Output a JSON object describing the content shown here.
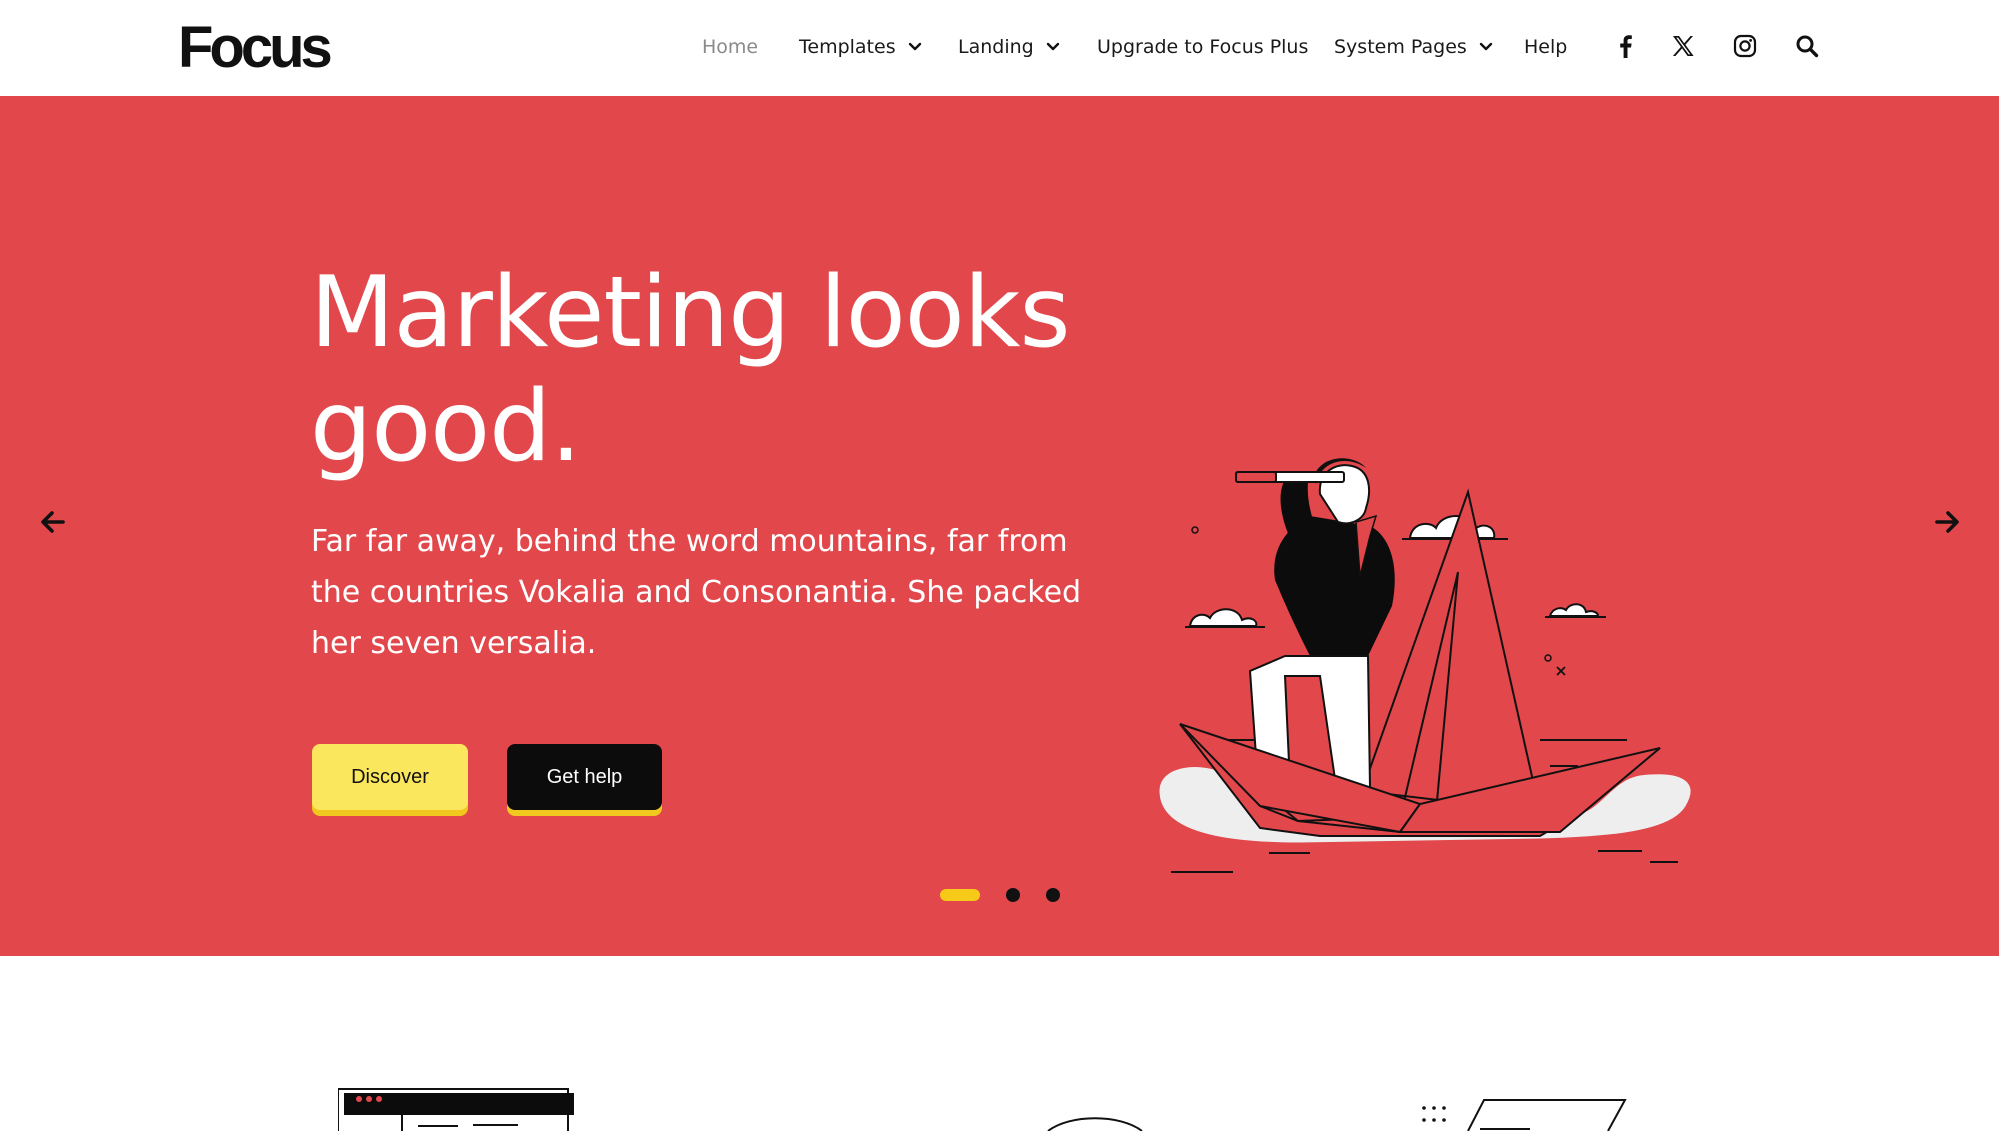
{
  "brand": {
    "logo": "Focus"
  },
  "nav": {
    "items": [
      {
        "label": "Home",
        "dropdown": false
      },
      {
        "label": "Templates",
        "dropdown": true
      },
      {
        "label": "Landing",
        "dropdown": true
      },
      {
        "label": "Upgrade to Focus Plus",
        "dropdown": false
      },
      {
        "label": "System Pages",
        "dropdown": true
      },
      {
        "label": "Help",
        "dropdown": false
      }
    ],
    "social_icons": [
      "facebook-icon",
      "x-icon",
      "instagram-icon",
      "search-icon"
    ]
  },
  "hero": {
    "title_line1": "Marketing looks",
    "title_line2": "good.",
    "text": "Far far away, behind the word mountains, far from the countries Vokalia and Consonantia. She packed her seven versalia.",
    "buttons": {
      "discover": "Discover",
      "get_help": "Get help"
    },
    "slide_count": 3,
    "active_slide": 1
  },
  "colors": {
    "hero_bg": "#e2474b",
    "accent_yellow": "#fbe75e",
    "button_dark": "#0c0c0c"
  }
}
